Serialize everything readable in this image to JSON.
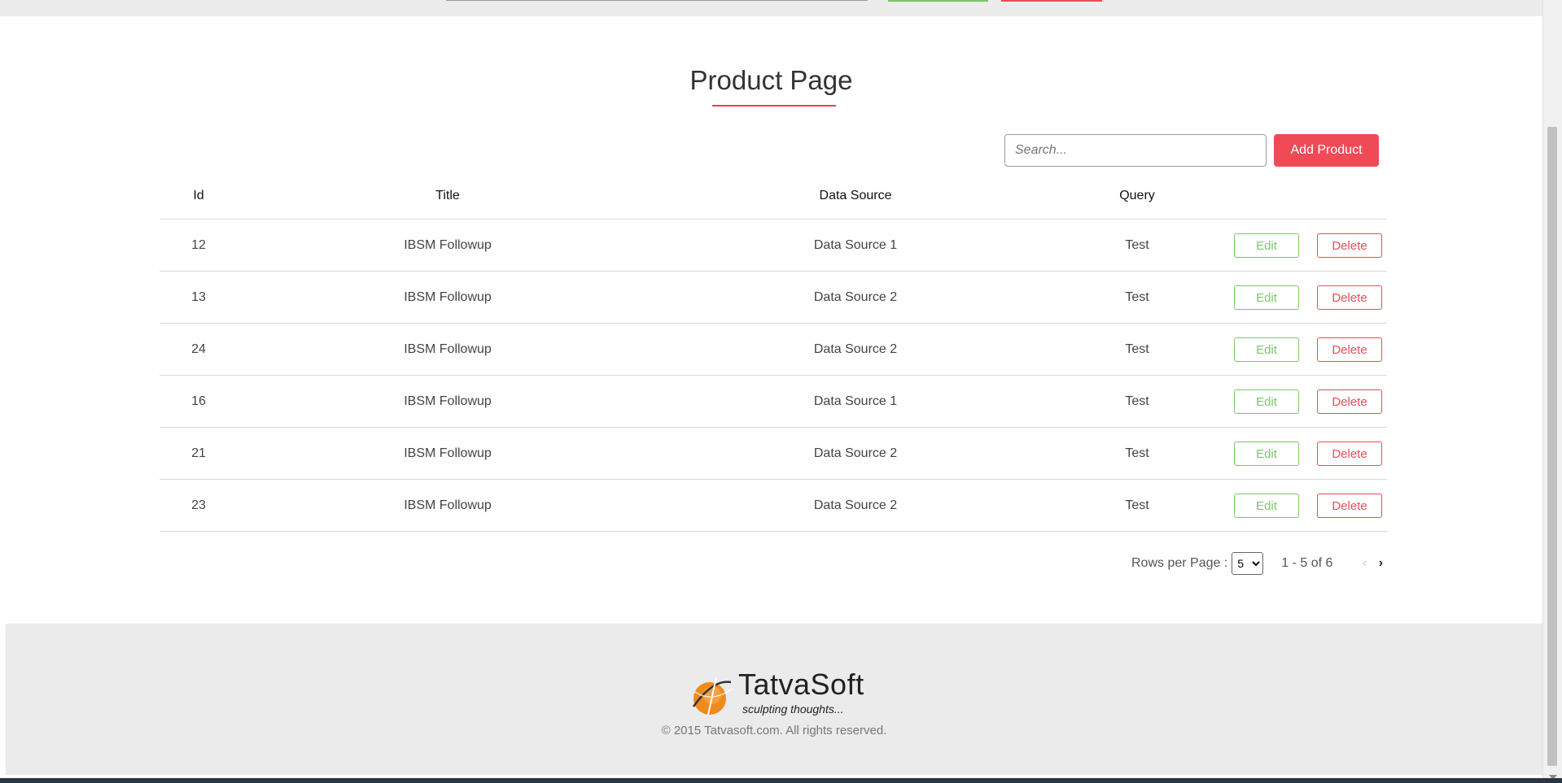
{
  "page": {
    "title": "Product Page"
  },
  "toolbar": {
    "search_placeholder": "Search...",
    "add_label": "Add Product"
  },
  "table": {
    "columns": [
      "Id",
      "Title",
      "Data Source",
      "Query"
    ],
    "rows": [
      {
        "id": "12",
        "title": "IBSM Followup",
        "source": "Data Source 1",
        "query": "Test"
      },
      {
        "id": "13",
        "title": "IBSM Followup",
        "source": "Data Source 2",
        "query": "Test"
      },
      {
        "id": "24",
        "title": "IBSM Followup",
        "source": "Data Source 2",
        "query": "Test"
      },
      {
        "id": "16",
        "title": "IBSM Followup",
        "source": "Data Source 1",
        "query": "Test"
      },
      {
        "id": "21",
        "title": "IBSM Followup",
        "source": "Data Source 2",
        "query": "Test"
      },
      {
        "id": "23",
        "title": "IBSM Followup",
        "source": "Data Source 2",
        "query": "Test"
      }
    ],
    "edit_label": "Edit",
    "delete_label": "Delete"
  },
  "pagination": {
    "rows_label": "Rows per Page :",
    "rows_value": "5",
    "range": "1 - 5 of 6",
    "prev_icon": "chevron-left-icon",
    "next_icon": "chevron-right-icon"
  },
  "footer": {
    "logo_name": "TatvaSoft",
    "logo_tagline": "sculpting thoughts...",
    "copyright": "© 2015 Tatvasoft.com. All rights reserved."
  },
  "colors": {
    "accent_red": "#f04a57",
    "accent_green": "#7cc56a",
    "footer_bg": "#ebebeb",
    "logo_orange": "#f08a1c"
  }
}
